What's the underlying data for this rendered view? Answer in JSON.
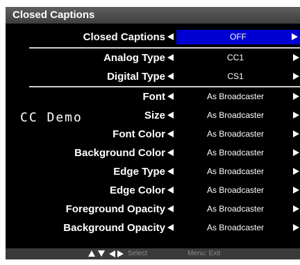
{
  "title": "Closed Captions",
  "rows": [
    {
      "label": "Closed Captions",
      "value": "OFF"
    },
    {
      "label": "Analog Type",
      "value": "CC1"
    },
    {
      "label": "Digital Type",
      "value": "CS1"
    },
    {
      "label": "Font",
      "value": "As Broadcaster"
    },
    {
      "label": "Size",
      "value": "As Broadcaster"
    },
    {
      "label": "Font Color",
      "value": "As Broadcaster"
    },
    {
      "label": "Background Color",
      "value": "As Broadcaster"
    },
    {
      "label": "Edge Type",
      "value": "As Broadcaster"
    },
    {
      "label": "Edge Color",
      "value": "As Broadcaster"
    },
    {
      "label": "Foreground Opacity",
      "value": "As Broadcaster"
    },
    {
      "label": "Background Opacity",
      "value": "As Broadcaster"
    }
  ],
  "selected_row": "Closed Captions",
  "cc_demo": "CC Demo",
  "footer": {
    "nav_icons": [
      "triangle-up-icon",
      "triangle-down-icon",
      "triangle-left-icon",
      "triangle-right-icon"
    ],
    "select_hint": "Select",
    "exit_hint": "Menu: Exit"
  },
  "colors": {
    "background": "#000000",
    "selected_highlight": "#0000d2",
    "title_bar": "#4a4a4a",
    "footer_bar": "#3a3a3a",
    "text": "#ffffff",
    "footer_text": "#8a8a8a"
  }
}
